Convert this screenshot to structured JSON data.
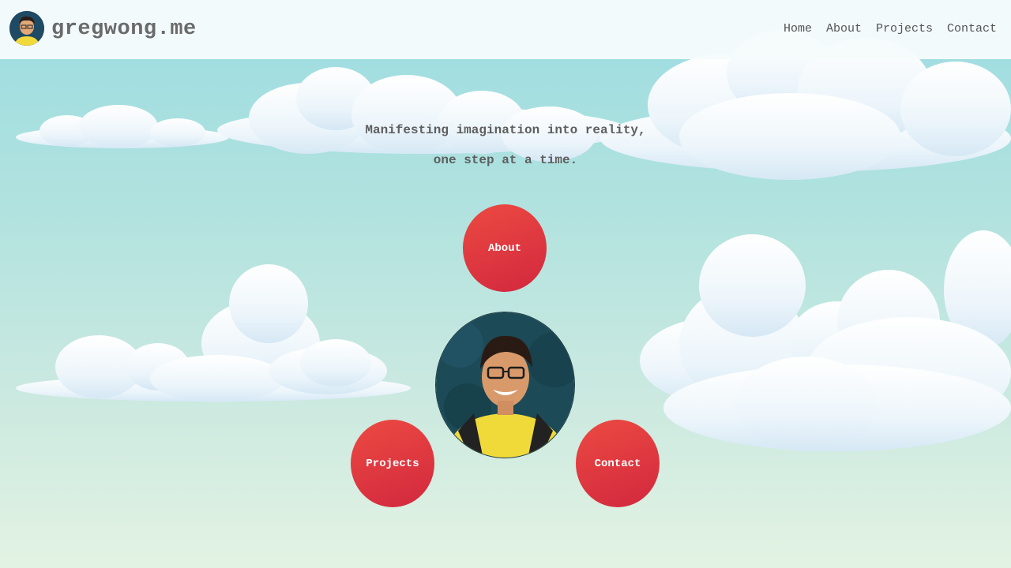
{
  "header": {
    "brand": "gregwong.me",
    "nav": [
      "Home",
      "About",
      "Projects",
      "Contact"
    ]
  },
  "hero": {
    "tagline_line1": "Manifesting imagination into reality,",
    "tagline_line2": "one step at a time.",
    "buttons": {
      "about": "About",
      "projects": "Projects",
      "contact": "Contact"
    }
  },
  "colors": {
    "button": "#e03a40",
    "sky_top": "#9cdce2",
    "sky_bottom": "#e3f3e3",
    "brand_text": "#6a6a6a"
  },
  "icons": [
    "avatar-photo",
    "portrait-photo"
  ]
}
